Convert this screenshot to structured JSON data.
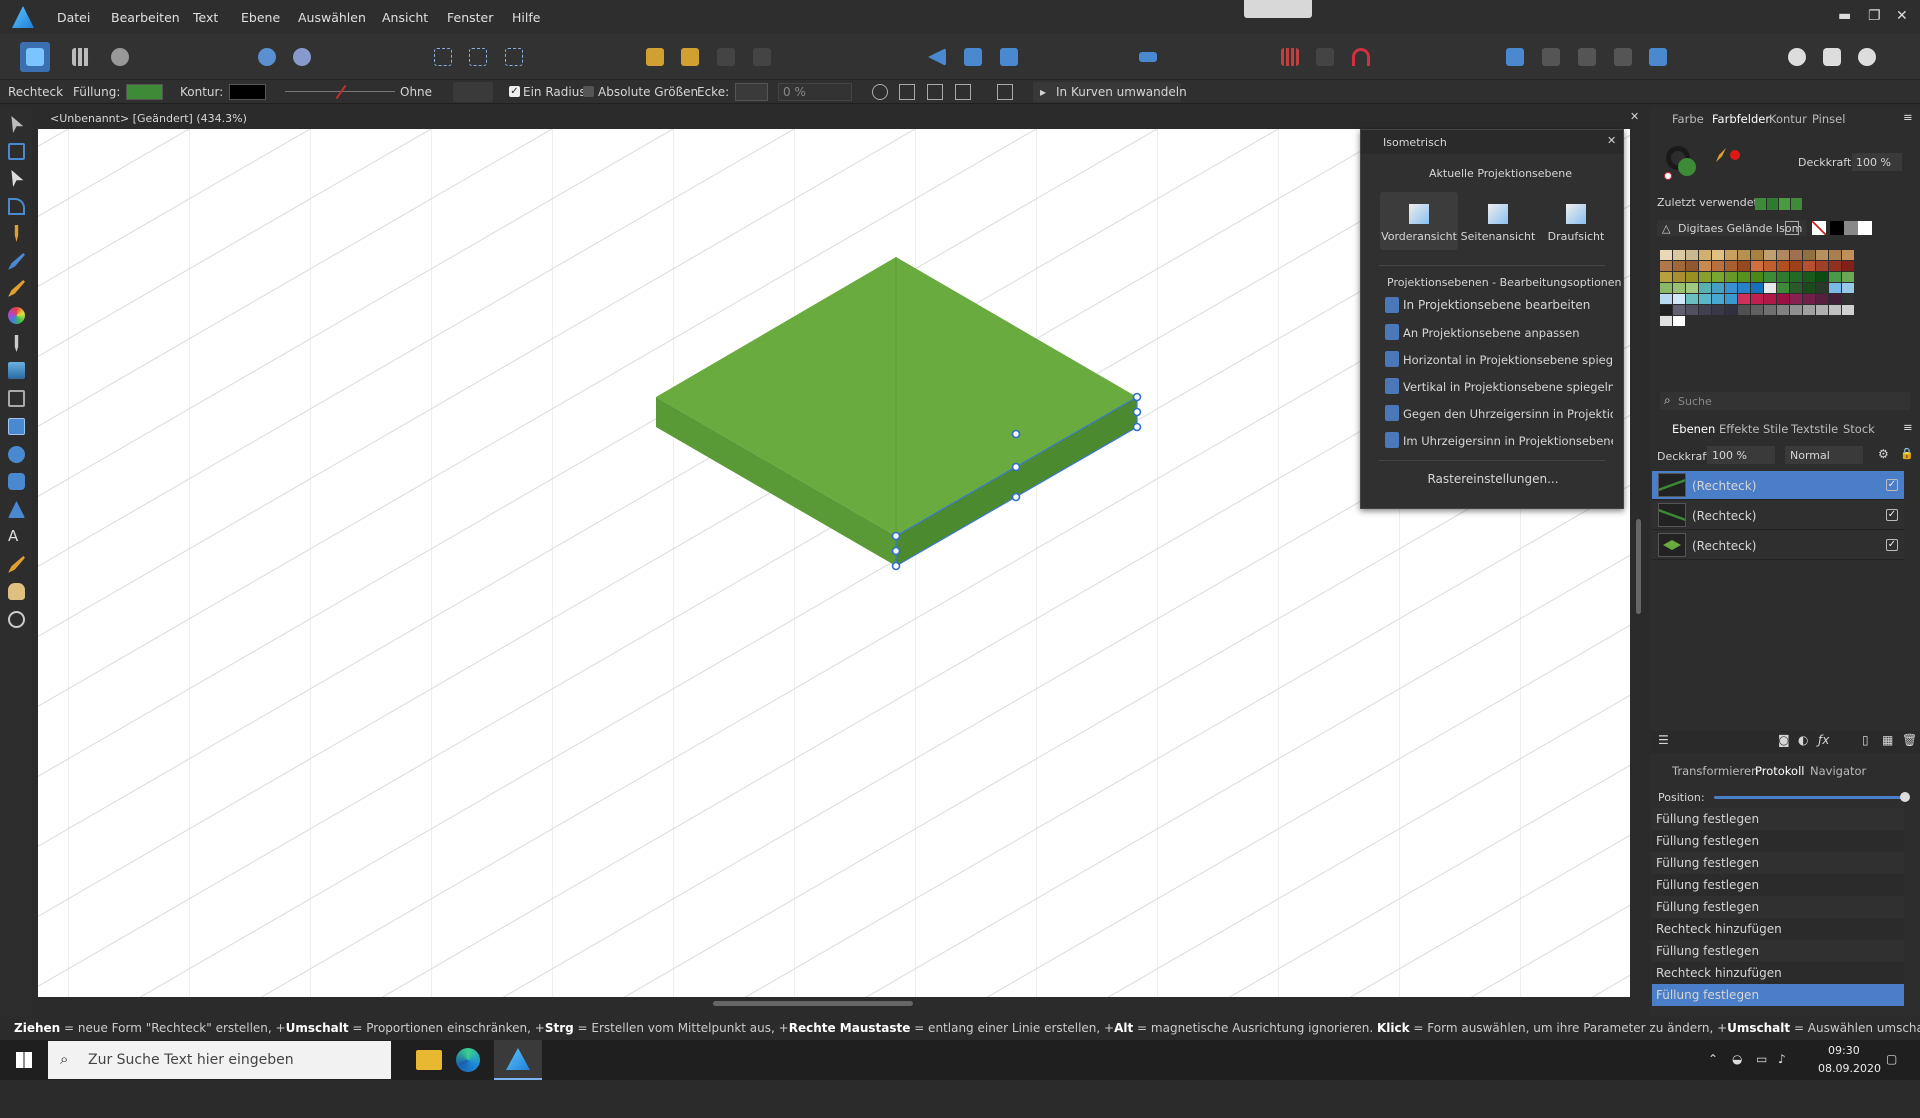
{
  "menu": {
    "items": [
      "Datei",
      "Bearbeiten",
      "Text",
      "Ebene",
      "Auswählen",
      "Ansicht",
      "Fenster",
      "Hilfe"
    ]
  },
  "context": {
    "tool_name": "Rechteck",
    "fill_label": "Füllung:",
    "fill_color": "#3d8b37",
    "stroke_label": "Kontur:",
    "stroke_color": "#000000",
    "stroke_none": "Ohne",
    "one_radius": "Ein Radius",
    "absolute_sizes": "Absolute Größen",
    "corner_label": "Ecke:",
    "corner_value": "0 %",
    "convert_label": "In Kurven umwandeln"
  },
  "document": {
    "title": "<Unbenannt> [Geändert] (434.3%)"
  },
  "iso": {
    "title": "Isometrisch",
    "section1": "Aktuelle Projektionsebene",
    "views": [
      "Vorderansicht",
      "Seitenansicht",
      "Draufsicht"
    ],
    "section2": "Projektionsebenen - Bearbeitungsoptionen",
    "options": [
      "In Projektionsebene bearbeiten",
      "An Projektionsebene anpassen",
      "Horizontal in Projektionsebene spiegeln",
      "Vertikal in Projektionsebene spiegeln",
      "Gegen den Uhrzeigersinn in Projektionsebene drehen",
      "Im Uhrzeigersinn in Projektionsebene drehen"
    ],
    "grid_button": "Rastereinstellungen..."
  },
  "panel_top": {
    "tabs": [
      "Farbe",
      "Farbfelder",
      "Kontur",
      "Pinsel"
    ],
    "opacity_label": "Deckkraft:",
    "opacity_value": "100 %",
    "recent_label": "Zuletzt verwendet:",
    "palette_name": "Digitaes Gelände Isom",
    "search_placeholder": "Suche",
    "swatches": [
      "#e8d8b8",
      "#d9c8a0",
      "#c9b890",
      "#d0b070",
      "#e0c080",
      "#c8a060",
      "#b89050",
      "#a88040",
      "#c0a070",
      "#b08860",
      "#a07050",
      "#907040",
      "#b89060",
      "#a88050",
      "#c09058",
      "#b07848",
      "#a06838",
      "#905830",
      "#c88a50",
      "#b87040",
      "#a86030",
      "#984820",
      "#d07040",
      "#c06030",
      "#b05020",
      "#a04018",
      "#b85030",
      "#a04028",
      "#903020",
      "#802018",
      "#b8a040",
      "#a89030",
      "#989020",
      "#88a030",
      "#78a830",
      "#689828",
      "#589020",
      "#4a8818",
      "#3d8b37",
      "#2f7a2e",
      "#226a25",
      "#185a1c",
      "#0e4a14",
      "#4a9848",
      "#6aa858",
      "#8ab868",
      "#9ac070",
      "#a0c880",
      "#58b0b0",
      "#48a0c0",
      "#3890d0",
      "#2880c8",
      "#1870b8",
      "#e8e8e8",
      "#3d8b37",
      "#2a5a2a",
      "#1a4a1a",
      "#2a3a2a",
      "#7ab8e8",
      "#98c8e8",
      "#b8d8f0",
      "#d0e8f8",
      "#68c0c0",
      "#58b8c8",
      "#48a8d0",
      "#3898d0",
      "#d0305a",
      "#c02050",
      "#b01848",
      "#9a1040",
      "#882050",
      "#702048",
      "#582040",
      "#402038",
      "#303030",
      "#202020",
      "#606070",
      "#505060",
      "#404050",
      "#383848",
      "#303040",
      "#505050",
      "#606060",
      "#707070",
      "#808080",
      "#909090",
      "#a0a0a0",
      "#b0b0b0",
      "#c0c0c0",
      "#d0d0d0",
      "#e0e0e0",
      "#ffffff"
    ],
    "recent_colors": [
      "#3d8b37",
      "#2f7a2e",
      "#4a9a40",
      "#3d8b37"
    ]
  },
  "layers": {
    "tabs": [
      "Ebenen",
      "Effekte",
      "Stile",
      "Textstile",
      "Stock"
    ],
    "opacity_label": "Deckkraft:",
    "opacity_value": "100 %",
    "blend_mode": "Normal",
    "items": [
      {
        "name": "(Rechteck)",
        "selected": true
      },
      {
        "name": "(Rechteck)",
        "selected": false
      },
      {
        "name": "(Rechteck)",
        "selected": false
      }
    ]
  },
  "history": {
    "tabs": [
      "Transformieren",
      "Protokoll",
      "Navigator"
    ],
    "position_label": "Position:",
    "position_value": 1.0,
    "items": [
      "Füllung festlegen",
      "Füllung festlegen",
      "Füllung festlegen",
      "Füllung festlegen",
      "Füllung festlegen",
      "Rechteck hinzufügen",
      "Füllung festlegen",
      "Rechteck hinzufügen",
      "Füllung festlegen"
    ]
  },
  "status": {
    "parts": [
      {
        "b": "Ziehen",
        "t": " = neue Form \"Rechteck\" erstellen, +"
      },
      {
        "b": "Umschalt",
        "t": " = Proportionen einschränken, +"
      },
      {
        "b": "Strg",
        "t": " = Erstellen vom Mittelpunkt aus, +"
      },
      {
        "b": "Rechte Maustaste",
        "t": " = entlang einer Linie erstellen, +"
      },
      {
        "b": "Alt",
        "t": " = magnetische Ausrichtung ignorieren. "
      },
      {
        "b": "Klick",
        "t": " = Form auswählen, um ihre Parameter zu ändern, +"
      },
      {
        "b": "Umschalt",
        "t": " = Auswählen umschalten."
      }
    ]
  },
  "taskbar": {
    "search_placeholder": "Zur Suche Text hier eingeben",
    "time": "09:30",
    "date": "08.09.2020"
  },
  "colors": {
    "accent": "#4a7ec8",
    "top_face": "#6aab3f",
    "left_face": "#5a9a36",
    "right_face": "#4c8a30"
  }
}
